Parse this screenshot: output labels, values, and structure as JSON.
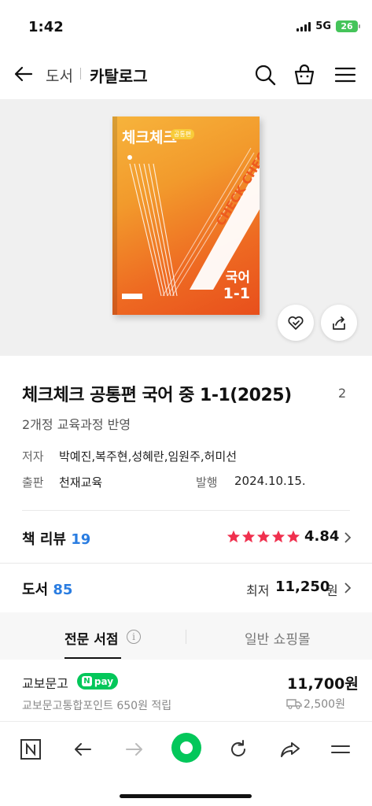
{
  "status": {
    "time": "1:42",
    "network": "5G",
    "battery": "26"
  },
  "header": {
    "breadcrumb_parent": "도서",
    "breadcrumb_current": "카탈로그"
  },
  "cover": {
    "series": "체크체크",
    "tag": "공통편",
    "diagonal_text": "CHECK CHECK",
    "subject": "국어",
    "grade": "1-1"
  },
  "book": {
    "title": "체크체크 공통편 국어 중 1-1(2025)",
    "title_badge": "2",
    "subtitle": "2개정 교육과정 반영",
    "author_label": "저자",
    "author": "박예진,복주현,성혜란,임원주,허미선",
    "publisher_label": "출판",
    "publisher": "천재교육",
    "date_label": "발행",
    "date": "2024.10.15."
  },
  "review": {
    "label": "책 리뷰",
    "count": "19",
    "rating": "4.84",
    "stars": 5
  },
  "books": {
    "label": "도서",
    "count": "85",
    "lowest_label": "최저",
    "lowest_price": "11,250",
    "unit": "원"
  },
  "tabs": [
    {
      "label": "전문 서점"
    },
    {
      "label": "일반 쇼핑몰"
    }
  ],
  "store": {
    "name": "교보문고",
    "pay_label": "pay",
    "pay_n": "N",
    "price": "11,700원",
    "point": "교보문고통합포인트 650원 적립",
    "shipping": "2,500원"
  },
  "colors": {
    "accent": "#03c75a",
    "link": "#2a7de1",
    "star": "#f0304e"
  }
}
